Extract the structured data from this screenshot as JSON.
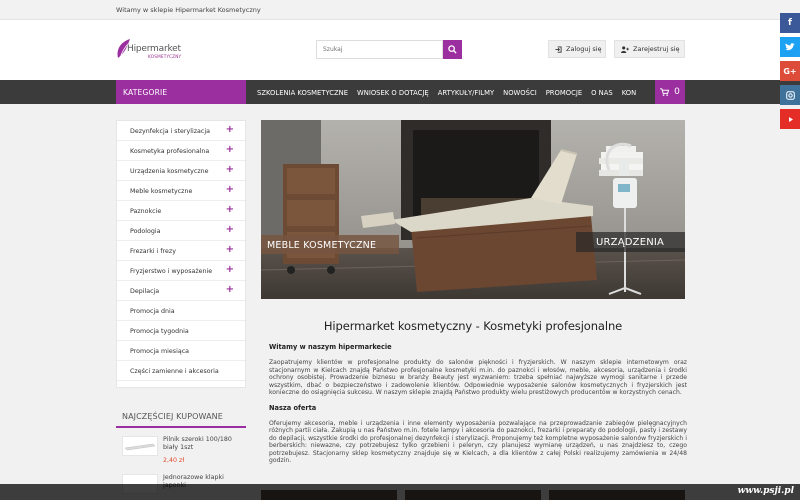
{
  "topbar": {
    "welcome": "Witamy w sklepie Hipermarket Kosmetyczny"
  },
  "logo": {
    "name": "Hipermarket",
    "tagline": "KOSMETYCZNY"
  },
  "search": {
    "placeholder": "Szukaj"
  },
  "header": {
    "login": "Zaloguj się",
    "register": "Zarejestruj się"
  },
  "nav": {
    "categories": "KATEGORIE",
    "items": [
      "SZKOLENIA KOSMETYCZNE",
      "WNIOSEK O DOTACJĘ",
      "ARTYKUŁY/FILMY",
      "NOWOŚCI",
      "PROMOCJE",
      "O NAS",
      "KON"
    ],
    "cart_count": "0"
  },
  "sidebar": {
    "items": [
      {
        "label": "Dezynfekcja i sterylizacja",
        "plus": "+"
      },
      {
        "label": "Kosmetyka profesionalna",
        "plus": "+"
      },
      {
        "label": "Urządzenia kosmetyczne",
        "plus": "+"
      },
      {
        "label": "Meble kosmetyczne",
        "plus": "+"
      },
      {
        "label": "Paznokcie",
        "plus": "+"
      },
      {
        "label": "Podologia",
        "plus": "+"
      },
      {
        "label": "Frezarki i frezy",
        "plus": "+"
      },
      {
        "label": "Fryzjerstwo i wyposażenie",
        "plus": "+"
      },
      {
        "label": "Depilacja",
        "plus": "+"
      },
      {
        "label": "Promocja dnia",
        "plus": ""
      },
      {
        "label": "Promocja tygodnia",
        "plus": ""
      },
      {
        "label": "Promocja miesiąca",
        "plus": ""
      },
      {
        "label": "Części zamienne i akcesoria",
        "plus": ""
      }
    ]
  },
  "popular": {
    "heading": "NAJCZĘŚCIEJ KUPOWANE",
    "products": [
      {
        "name": "Pilnik szeroki 100/180 biały 1szt",
        "price": "2,40 zł"
      },
      {
        "name": "Jednorazowe klapki japonki",
        "price": ""
      }
    ]
  },
  "banner": {
    "left_label_a": "MEBLE",
    "left_label_b": " KOSMETYCZNE",
    "right_label": "URZĄDZENIA"
  },
  "content": {
    "title": "Hipermarket kosmetyczny - Kosmetyki profesjonalne",
    "welcome_heading": "Witamy w naszym hipermarkecie",
    "welcome_text": "Zaopatrujemy klientów w profesjonalne produkty do salonów piękności i fryzjerskich. W naszym sklepie internetowym oraz stacjonarnym w Kielcach znajdą Państwo profesjonalne kosmetyki m.in. do paznokci i włosów, meble, akcesoria, urządzenia i środki ochrony osobistej. Prowadzenie biznesu w branży Beauty jest wyzwaniem: trzeba spełniać najwyższe wymogi sanitarne i przede wszystkim, dbać o bezpieczeństwo i zadowolenie klientów. Odpowiednie wyposażenie salonów kosmetycznych i fryzjerskich jest konieczne do osiągnięcia sukcesu. W naszym sklepie znajdą Państwo produkty wielu prestiżowych producentów w korzystnych cenach.",
    "offer_heading": "Nasza oferta",
    "offer_text": "Oferujemy akcesoria, meble i urządzenia i inne elementy wyposażenia pozwalające na przeprowadzanie zabiegów pielęgnacyjnych różnych partii ciała. Zakupią u nas Państwo m.in. fotele lampy i akcesoria do paznokci, frezarki i preparaty do podologii, pasty i zestawy do depilacji, wszystkie środki do profesjonalnej dezynfekcji i sterylizacji. Proponujemy też kompletne wyposażenie salonów fryzjerskich i berberskich: niewazne, czy potrzebujesz tylko grzebieni i peleryn, czy planujesz wymianę urządzeń, u nas znajdziesz to, czego potrzebujesz. Stacjonarny sklep kosmetyczny znajduje się w Kielcach, a dla klientów z całej Polski realizujemy zamówienia w 24/48 godzin."
  },
  "watermark": "www.psji.pl",
  "colors": {
    "accent": "#9b2fa0",
    "nav_bg": "#3b3b3b",
    "price": "#e04b26"
  }
}
